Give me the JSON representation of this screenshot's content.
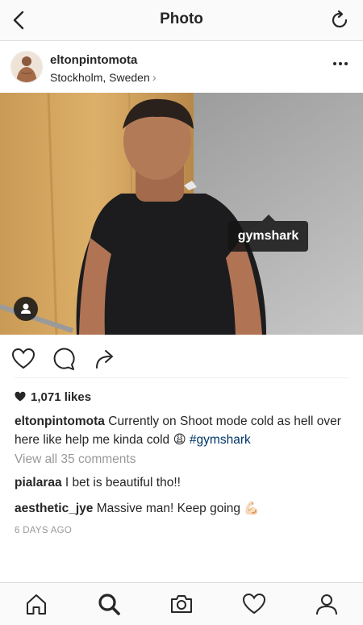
{
  "header": {
    "title": "Photo"
  },
  "post": {
    "username": "eltonpintomota",
    "location": "Stockholm, Sweden",
    "location_chevron": "›",
    "photo_tag": "gymshark",
    "likes_count": "1,071 likes",
    "caption_user": "eltonpintomota",
    "caption_text": "Currently on Shoot mode cold as hell over here like help me kinda cold 😩",
    "caption_hashtag": "#gymshark",
    "view_comments": "View all 35 comments",
    "comments": [
      {
        "user": "pialaraa",
        "text": "I bet is beautiful tho!!"
      },
      {
        "user": "aesthetic_jye",
        "text": "Massive man! Keep going 💪🏻"
      }
    ],
    "time_ago": "6 DAYS AGO"
  },
  "icons": {
    "back": "back-arrow-icon",
    "refresh": "refresh-icon",
    "more": "more-options-icon",
    "like": "heart-icon",
    "comment": "comment-bubble-icon",
    "share": "share-arrow-icon",
    "tags": "person-tag-icon",
    "nav": [
      "home-icon",
      "search-icon",
      "camera-icon",
      "activity-heart-icon",
      "profile-icon"
    ]
  },
  "colors": {
    "hashtag": "#003569",
    "muted": "#999999",
    "text": "#262626"
  }
}
